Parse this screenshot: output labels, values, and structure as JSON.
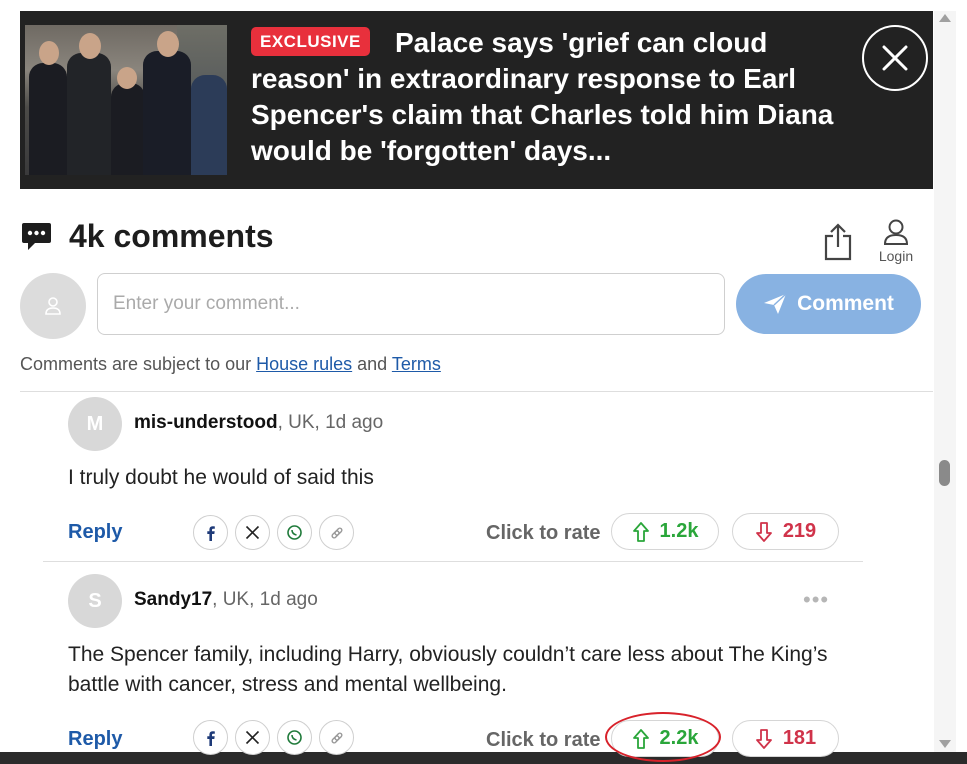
{
  "article": {
    "badge": "EXCLUSIVE",
    "headline": "Palace says 'grief can cloud reason' in extraordinary response to Earl Spencer's claim that Charles told him Diana would be 'forgotten' days..."
  },
  "comments": {
    "count_label": "4k comments",
    "login_label": "Login",
    "input_placeholder": "Enter your comment...",
    "submit_label": "Comment",
    "rules_prefix": "Comments are subject to our ",
    "house_rules": "House rules",
    "rules_and": " and ",
    "terms": "Terms"
  },
  "thread": [
    {
      "initial": "M",
      "username": "mis-understood",
      "meta": ", UK, 1d ago",
      "body": "I truly doubt he would of said this",
      "reply_label": "Reply",
      "rate_label": "Click to rate",
      "upvotes": "1.2k",
      "downvotes": "219"
    },
    {
      "initial": "S",
      "username": "Sandy17",
      "meta": ", UK, 1d ago",
      "body": "The Spencer family, including Harry, obviously couldn’t care less about The King’s battle with cancer, stress and mental wellbeing.",
      "reply_label": "Reply",
      "rate_label": "Click to rate",
      "upvotes": "2.2k",
      "downvotes": "181"
    }
  ],
  "icons": {
    "comments": "speech-bubble-icon",
    "share": "share-icon",
    "login": "user-icon",
    "close": "close-icon",
    "send": "paper-plane-icon",
    "facebook": "facebook-icon",
    "x": "x-icon",
    "whatsapp": "whatsapp-icon",
    "link": "link-icon",
    "upvote": "arrow-up-icon",
    "downvote": "arrow-down-icon",
    "more": "more-dots-icon"
  },
  "colors": {
    "badge": "#e8303c",
    "banner": "#222222",
    "link": "#1e5aa8",
    "comment_button": "#88b2e2",
    "upvote": "#2aa63a",
    "downvote": "#d0334a",
    "annotation_ring": "#d8222b"
  }
}
